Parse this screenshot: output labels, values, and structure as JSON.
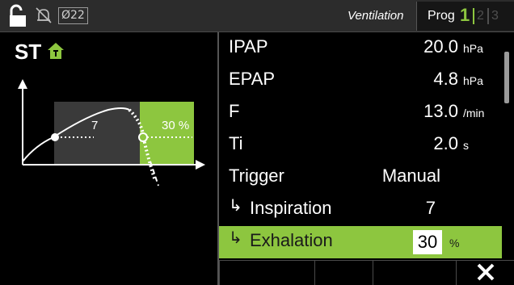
{
  "colors": {
    "accent": "#8dc63f",
    "background": "#000000",
    "statusbar": "#2c2c2c"
  },
  "statusbar": {
    "icons": [
      "unlock-icon",
      "alarm-silenced-icon"
    ],
    "badge": "Ø22",
    "mode_label": "Ventilation",
    "prog_label": "Prog",
    "programs": [
      "1",
      "2",
      "3"
    ],
    "active_program": "1"
  },
  "mode": {
    "name": "ST",
    "trigger_icon": "trigger-house-icon"
  },
  "diagram": {
    "inspiration_value": "7",
    "exhalation_value": "30 %"
  },
  "params": [
    {
      "label": "IPAP",
      "value": "20.0",
      "unit": "hPa"
    },
    {
      "label": "EPAP",
      "value": "4.8",
      "unit": "hPa"
    },
    {
      "label": "F",
      "value": "13.0",
      "unit": "/min"
    },
    {
      "label": "Ti",
      "value": "2.0",
      "unit": "s"
    },
    {
      "label": "Trigger",
      "value": "Manual",
      "unit": ""
    },
    {
      "label": "Inspiration",
      "value": "7",
      "unit": "",
      "sub": true
    },
    {
      "label": "Exhalation",
      "value": "30",
      "unit": "%",
      "sub": true,
      "selected": true
    }
  ],
  "sub_arrow": "↳",
  "bottombar": {
    "close_icon": "close-icon"
  }
}
